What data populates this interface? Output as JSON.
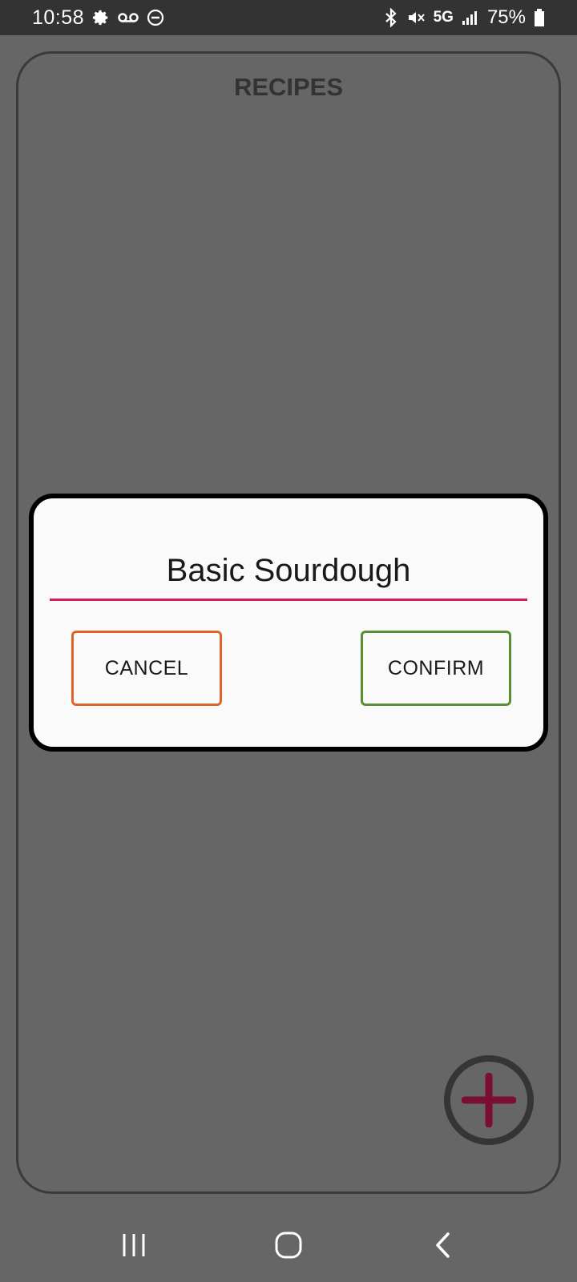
{
  "status_bar": {
    "time": "10:58",
    "network": "5G",
    "battery": "75%",
    "left_icons": [
      "gear-icon",
      "voicemail-icon",
      "do-not-disturb-icon"
    ],
    "right_icons": [
      "bluetooth-icon",
      "mute-icon",
      "signal-icon",
      "battery-icon"
    ]
  },
  "main": {
    "title": "RECIPES",
    "fab_icon": "plus-icon",
    "fab_color": "#7a0f33"
  },
  "dialog": {
    "input_value": "Basic Sourdough",
    "underline_color": "#d81b60",
    "cancel_label": "CANCEL",
    "cancel_color": "#e0642a",
    "confirm_label": "CONFIRM",
    "confirm_color": "#5a8f37"
  },
  "nav": {
    "buttons": [
      "recent-apps-icon",
      "home-icon",
      "back-icon"
    ]
  }
}
